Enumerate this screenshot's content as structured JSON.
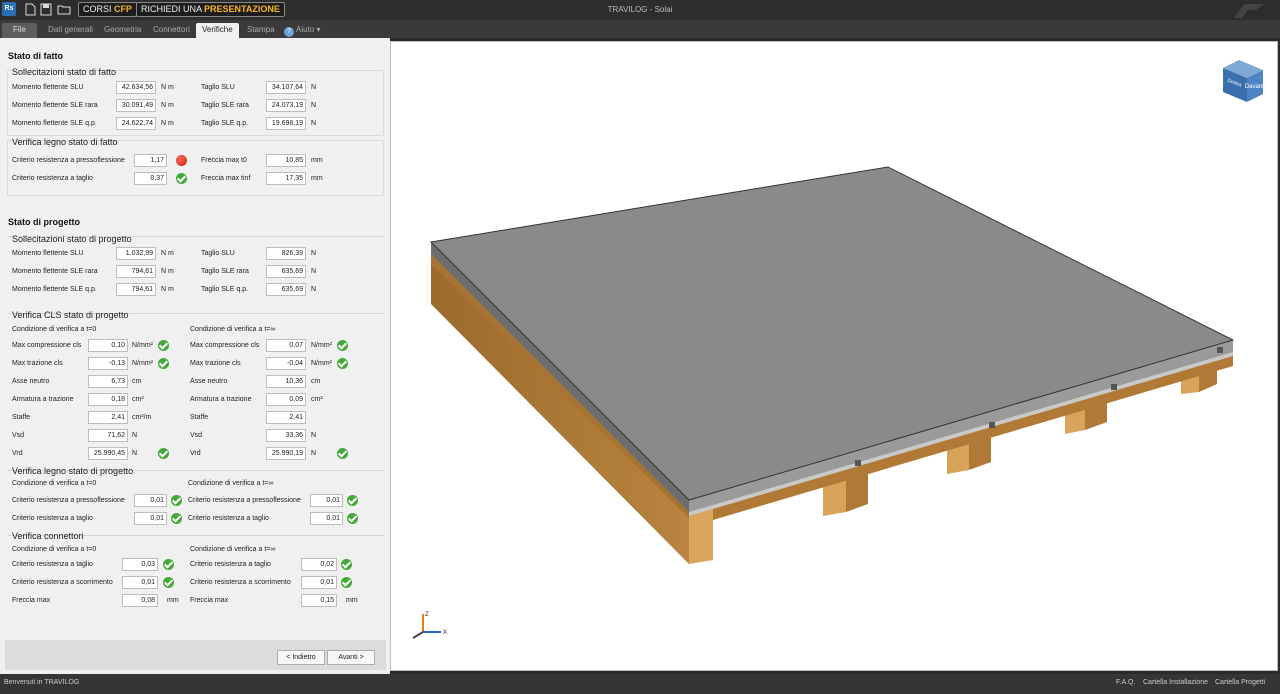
{
  "titlebar": {
    "app_icon": "Rs",
    "pill_corsi_prefix": "CORSI",
    "pill_corsi_suffix": "CFP",
    "pill_richiedi_prefix": "RICHIEDI UNA",
    "pill_richiedi_suffix": "PRESENTAZIONE",
    "window_title": "TRAVILOG - Solai",
    "icons": [
      "new-file-icon",
      "save-icon",
      "open-folder-icon"
    ]
  },
  "menu": {
    "file": "File",
    "tabs": [
      "Dati generali",
      "Geometria",
      "Connettori",
      "Verifiche",
      "Stampa"
    ],
    "active_tab": "Verifiche",
    "help": "Aiuto"
  },
  "fatto": {
    "title": "Stato di fatto",
    "soll": {
      "title": "Sollecitazioni stato di fatto",
      "m_slu_label": "Momento flettente SLU",
      "m_slu": "42.634,56",
      "m_unit": "N m",
      "m_rara_label": "Momento flettente SLE rara",
      "m_rara": "30.091,49",
      "m_qp_label": "Momento flettente SLE q.p.",
      "m_qp": "24.622,74",
      "t_slu_label": "Taglio SLU",
      "t_slu": "34.107,64",
      "t_unit": "N",
      "t_rara_label": "Taglio SLE rara",
      "t_rara": "24.073,19",
      "t_qp_label": "Taglio SLE q.p.",
      "t_qp": "19.698,19"
    },
    "legno": {
      "title": "Verifica legno stato di fatto",
      "press_label": "Criterio resistenza a pressoflessione",
      "press": "1,17",
      "taglio_label": "Criterio resistenza a taglio",
      "taglio": "0,37",
      "f0_label": "Freccia max t0",
      "f0": "10,85",
      "f_unit": "mm",
      "finf_label": "Freccia max tinf",
      "finf": "17,35"
    }
  },
  "progetto": {
    "title": "Stato di progetto",
    "soll": {
      "title": "Sollecitazioni stato di progetto",
      "m_slu": "1.032,99",
      "m_rara": "794,61",
      "m_qp": "794,61",
      "t_slu": "826,39",
      "t_rara": "635,69",
      "t_qp": "635,69"
    },
    "cls": {
      "title": "Verifica CLS stato di progetto",
      "cond0": "Condizione di verifica a t=0",
      "condinf": "Condizione di verifica a t=∞",
      "comp_label": "Max compressione cls",
      "traz_label": "Max trazione cls",
      "asse_label": "Asse neutro",
      "arm_label": "Armatura a trazione",
      "staffe_label": "Staffe",
      "vsd_label": "Vsd",
      "vrd_label": "Vrd",
      "unit_stress": "N/mm²",
      "unit_cm": "cm",
      "unit_cm2": "cm²",
      "unit_cm2m": "cm²/m",
      "unit_n": "N",
      "t0": {
        "comp": "0,10",
        "traz": "-0,13",
        "asse": "6,73",
        "arm": "0,18",
        "staffe": "2,41",
        "vsd": "71,62",
        "vrd": "25.990,45"
      },
      "tinf": {
        "comp": "0,07",
        "traz": "-0,04",
        "asse": "10,36",
        "arm": "0,09",
        "staffe": "2,41",
        "vsd": "33,36",
        "vrd": "25.990,19"
      }
    },
    "legno": {
      "title": "Verifica legno stato di progetto",
      "cond0": "Condizione di verifica a t=0",
      "condinf": "Condizione di verifica a t=∞",
      "press_label": "Criterio resistenza a pressoflessione",
      "taglio_label": "Criterio resistenza a taglio",
      "t0": {
        "press": "0,01",
        "taglio": "0,01"
      },
      "tinf": {
        "press": "0,01",
        "taglio": "0,01"
      }
    },
    "conn": {
      "title": "Verifica connettori",
      "cond0": "Condizione di verifica a t=0",
      "condinf": "Condizione di verifica a t=∞",
      "taglio_label": "Criterio resistenza a taglio",
      "scorr_label": "Criterio resistenza a scorrimento",
      "freccia_label": "Freccia max",
      "unit_mm": "mm",
      "t0": {
        "taglio": "0,03",
        "scorr": "0,01",
        "freccia": "0,08"
      },
      "tinf": {
        "taglio": "0,02",
        "scorr": "0,01",
        "freccia": "0,15"
      }
    }
  },
  "nav": {
    "back": "< Indietro",
    "next": "Avanti >"
  },
  "viewcube": {
    "face_front": "Davanti",
    "face_side": "Destra"
  },
  "axes": {
    "z": "Z",
    "x": "X"
  },
  "status": {
    "welcome": "Benvenuti in TRAVILOG",
    "faq": "F.A.Q.",
    "cartella_install": "Cartella Installazione",
    "cartella_progetti": "Cartella Progetti"
  },
  "colors": {
    "ok": "#45a83a",
    "bad": "#c81b0c",
    "wood": "#b9843f",
    "slab": "#8a8a8a"
  }
}
